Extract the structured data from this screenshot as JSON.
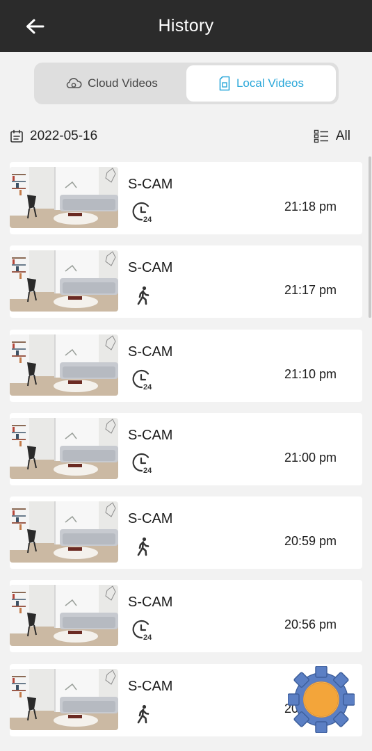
{
  "header": {
    "title": "History",
    "back_icon": "arrow-left-icon"
  },
  "tabs": [
    {
      "label": "Cloud Videos",
      "icon": "cloud-icon",
      "active": false
    },
    {
      "label": "Local Videos",
      "icon": "sd-card-icon",
      "active": true
    }
  ],
  "filter": {
    "date": "2022-05-16",
    "date_icon": "calendar-icon",
    "all_label": "All",
    "all_icon": "list-icon"
  },
  "colors": {
    "accent": "#2aa7d9",
    "header_bg": "#2b2b2b",
    "page_bg": "#f2f2f2"
  },
  "videos": [
    {
      "name": "S-CAM",
      "time": "21:18 pm",
      "type_icon": "clock-24-icon"
    },
    {
      "name": "S-CAM",
      "time": "21:17 pm",
      "type_icon": "person-walking-icon"
    },
    {
      "name": "S-CAM",
      "time": "21:10 pm",
      "type_icon": "clock-24-icon"
    },
    {
      "name": "S-CAM",
      "time": "21:00 pm",
      "type_icon": "clock-24-icon"
    },
    {
      "name": "S-CAM",
      "time": "20:59 pm",
      "type_icon": "person-walking-icon"
    },
    {
      "name": "S-CAM",
      "time": "20:56 pm",
      "type_icon": "clock-24-icon"
    },
    {
      "name": "S-CAM",
      "time": "20:56 pm",
      "type_icon": "person-walking-icon"
    }
  ],
  "overlay": {
    "icon": "gear-icon"
  }
}
